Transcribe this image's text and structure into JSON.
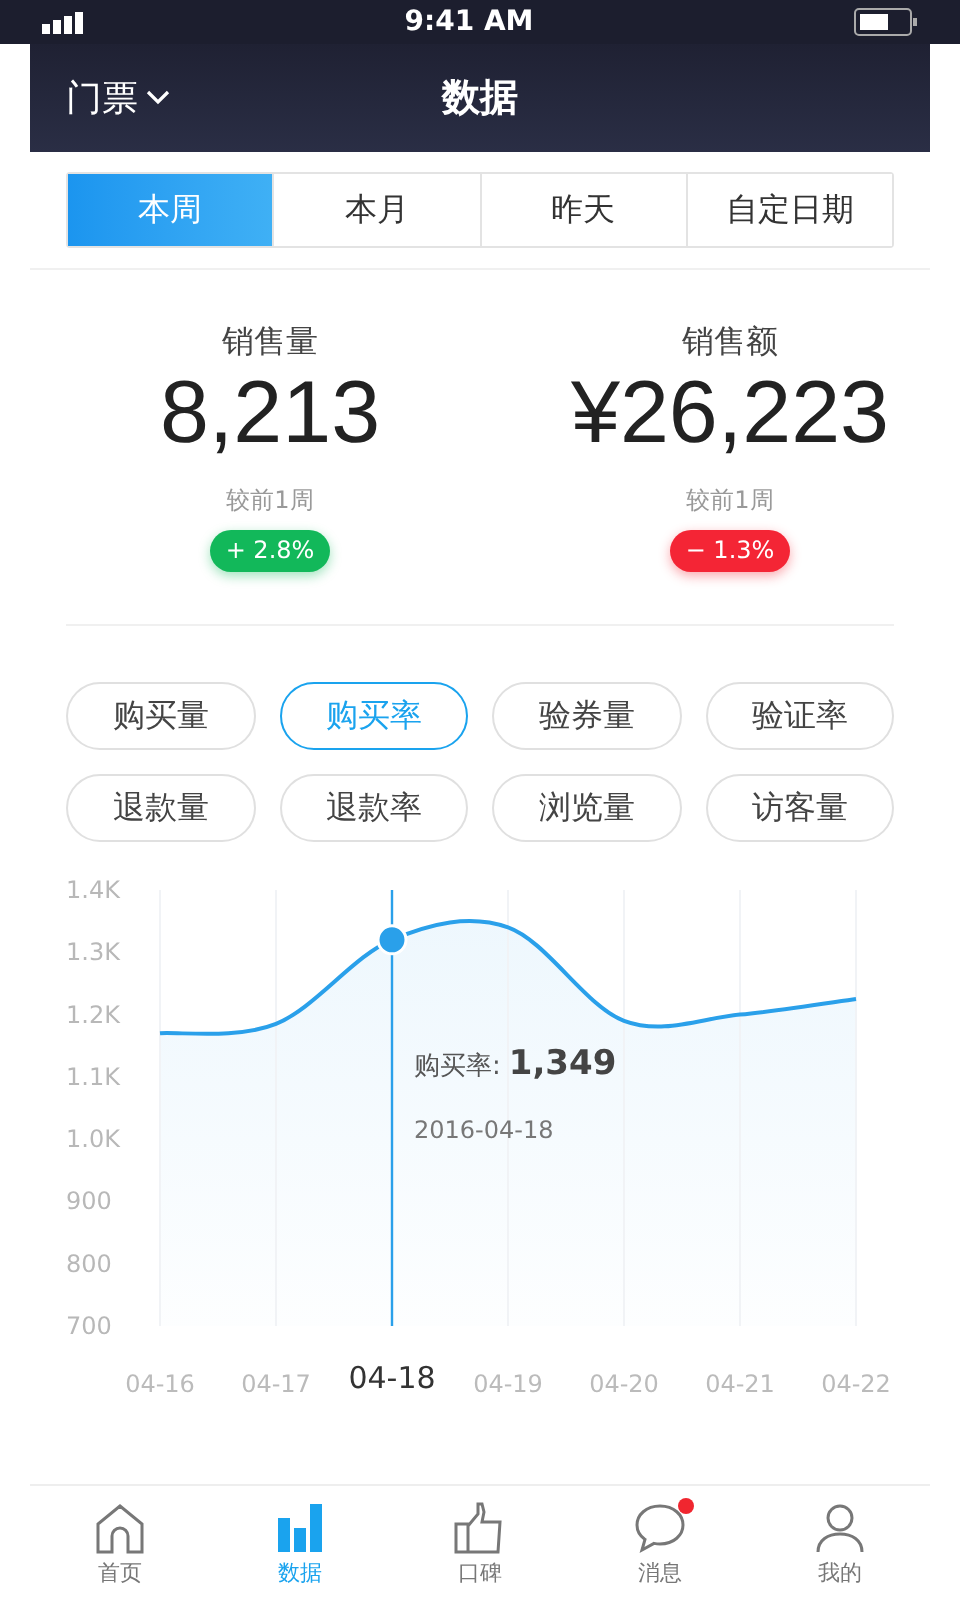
{
  "status_bar": {
    "time": "9:41 AM"
  },
  "nav": {
    "dropdown": "门票",
    "title": "数据"
  },
  "tabs": [
    {
      "label": "本周",
      "selected": true
    },
    {
      "label": "本月",
      "selected": false
    },
    {
      "label": "昨天",
      "selected": false
    },
    {
      "label": "自定日期",
      "selected": false
    }
  ],
  "stats": [
    {
      "label": "销售量",
      "value": "8,213",
      "compare": "较前1周",
      "change": "2.8%",
      "kind": "up"
    },
    {
      "label": "销售额",
      "value": "¥26,223",
      "compare": "较前1周",
      "change": "1.3%",
      "kind": "down"
    }
  ],
  "change_signs": {
    "up": "+",
    "down": "−"
  },
  "metrics": [
    {
      "label": "购买量",
      "selected": false
    },
    {
      "label": "购买率",
      "selected": true
    },
    {
      "label": "验券量",
      "selected": false
    },
    {
      "label": "验证率",
      "selected": false
    },
    {
      "label": "退款量",
      "selected": false
    },
    {
      "label": "退款率",
      "selected": false
    },
    {
      "label": "浏览量",
      "selected": false
    },
    {
      "label": "访客量",
      "selected": false
    }
  ],
  "chart": {
    "chart_data": {
      "type": "area",
      "grid": true,
      "categories": [
        "04-16",
        "04-17",
        "04-18",
        "04-19",
        "04-20",
        "04-21",
        "04-22"
      ],
      "series": [
        {
          "color": "#2aa0ea",
          "values": [
            1170,
            1185,
            1320,
            1340,
            1190,
            1200,
            1225
          ]
        }
      ],
      "ylim": [
        700,
        1400
      ],
      "ref_lines": [
        {
          "axis": "x",
          "value": "04-18",
          "color": "#2aa0ea"
        }
      ],
      "yticks": [
        {
          "value": 1400,
          "label": "1.4K"
        },
        {
          "value": 1300,
          "label": "1.3K"
        },
        {
          "value": 1200,
          "label": "1.2K"
        },
        {
          "value": 1100,
          "label": "1.1K"
        },
        {
          "value": 1000,
          "label": "1.0K"
        },
        {
          "value": 900,
          "label": "900"
        },
        {
          "value": 800,
          "label": "800"
        },
        {
          "value": 700,
          "label": "700"
        }
      ]
    },
    "point_selected": [
      false,
      false,
      true,
      false,
      false,
      false,
      false
    ],
    "tooltip": {
      "label": "购买率:",
      "value": "1,349",
      "date": "2016-04-18"
    }
  },
  "tab_bar": [
    {
      "label": "首页",
      "kind": "home",
      "selected": false,
      "badge": false
    },
    {
      "label": "数据",
      "kind": "bars",
      "selected": true,
      "badge": false
    },
    {
      "label": "口碑",
      "kind": "thumb",
      "selected": false,
      "badge": false
    },
    {
      "label": "消息",
      "kind": "chat",
      "selected": false,
      "badge": true
    },
    {
      "label": "我的",
      "kind": "user",
      "selected": false,
      "badge": false
    }
  ]
}
